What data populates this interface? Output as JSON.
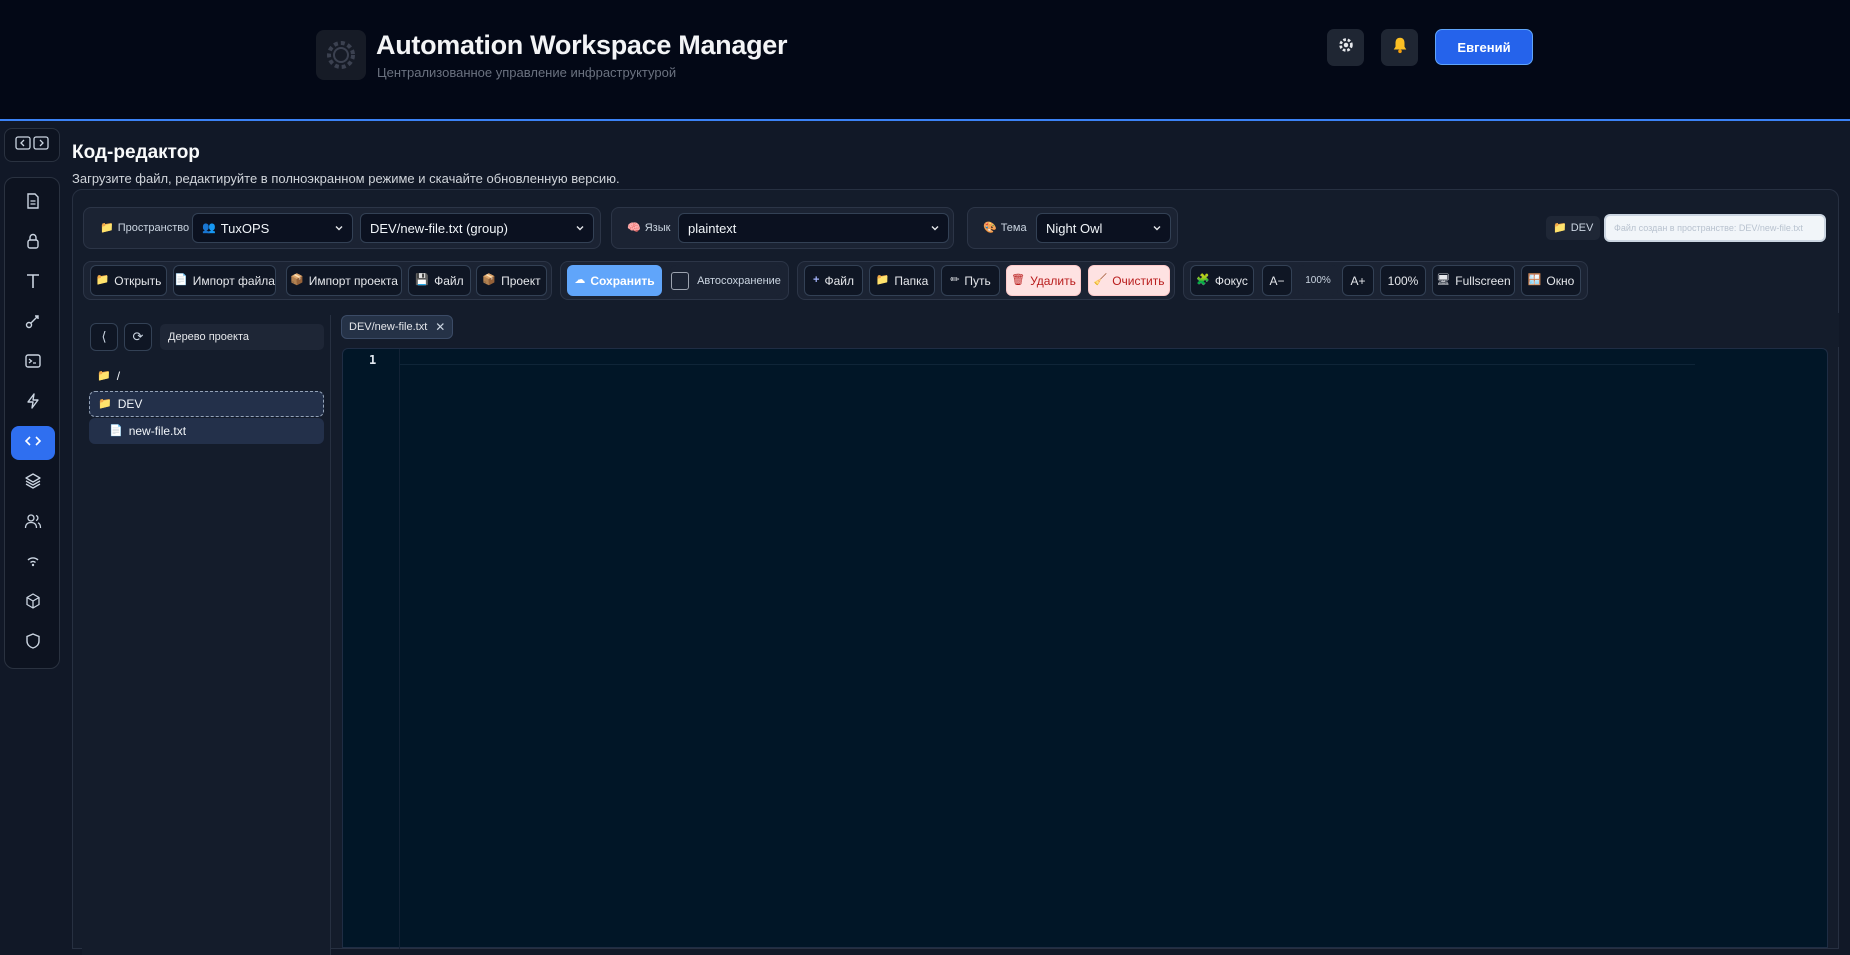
{
  "app": {
    "title": "Automation Workspace Manager",
    "subtitle": "Централизованное управление инфраструктурой",
    "user": "Евгений"
  },
  "page": {
    "title": "Код-редактор",
    "subtitle": "Загрузите файл, редактируйте в полноэкранном режиме и скачайте обновленную версию."
  },
  "selectors": {
    "space_label": "Пространство",
    "space_value": "TuxOPS",
    "file_value": "DEV/new-file.txt (group)",
    "lang_label": "Язык",
    "lang_value": "plaintext",
    "theme_label": "Тема",
    "theme_value": "Night Owl",
    "space_badge": "DEV",
    "status_placeholder": "Файл создан в пространстве: DEV/new-file.txt"
  },
  "toolbar": {
    "open": "Открыть",
    "import_file": "Импорт файла",
    "import_project": "Импорт проекта",
    "file": "Файл",
    "project": "Проект",
    "save": "Сохранить",
    "autosave": "Автосохранение",
    "new_file": "Файл",
    "new_folder": "Папка",
    "path": "Путь",
    "delete": "Удалить",
    "clear": "Очистить",
    "focus": "Фокус",
    "font_dec": "A−",
    "font_size": "100%",
    "font_inc": "A+",
    "zoom": "100%",
    "fullscreen": "Fullscreen",
    "window": "Окно"
  },
  "tree": {
    "search_placeholder": "Дерево проекта",
    "items": [
      {
        "label": "/"
      },
      {
        "label": "DEV"
      },
      {
        "label": "new-file.txt"
      }
    ]
  },
  "editor": {
    "tab": "DEV/new-file.txt",
    "line_number": "1"
  },
  "colors": {
    "accent": "#2563eb",
    "editor_bg": "#011627",
    "danger": "#b91c1c"
  }
}
